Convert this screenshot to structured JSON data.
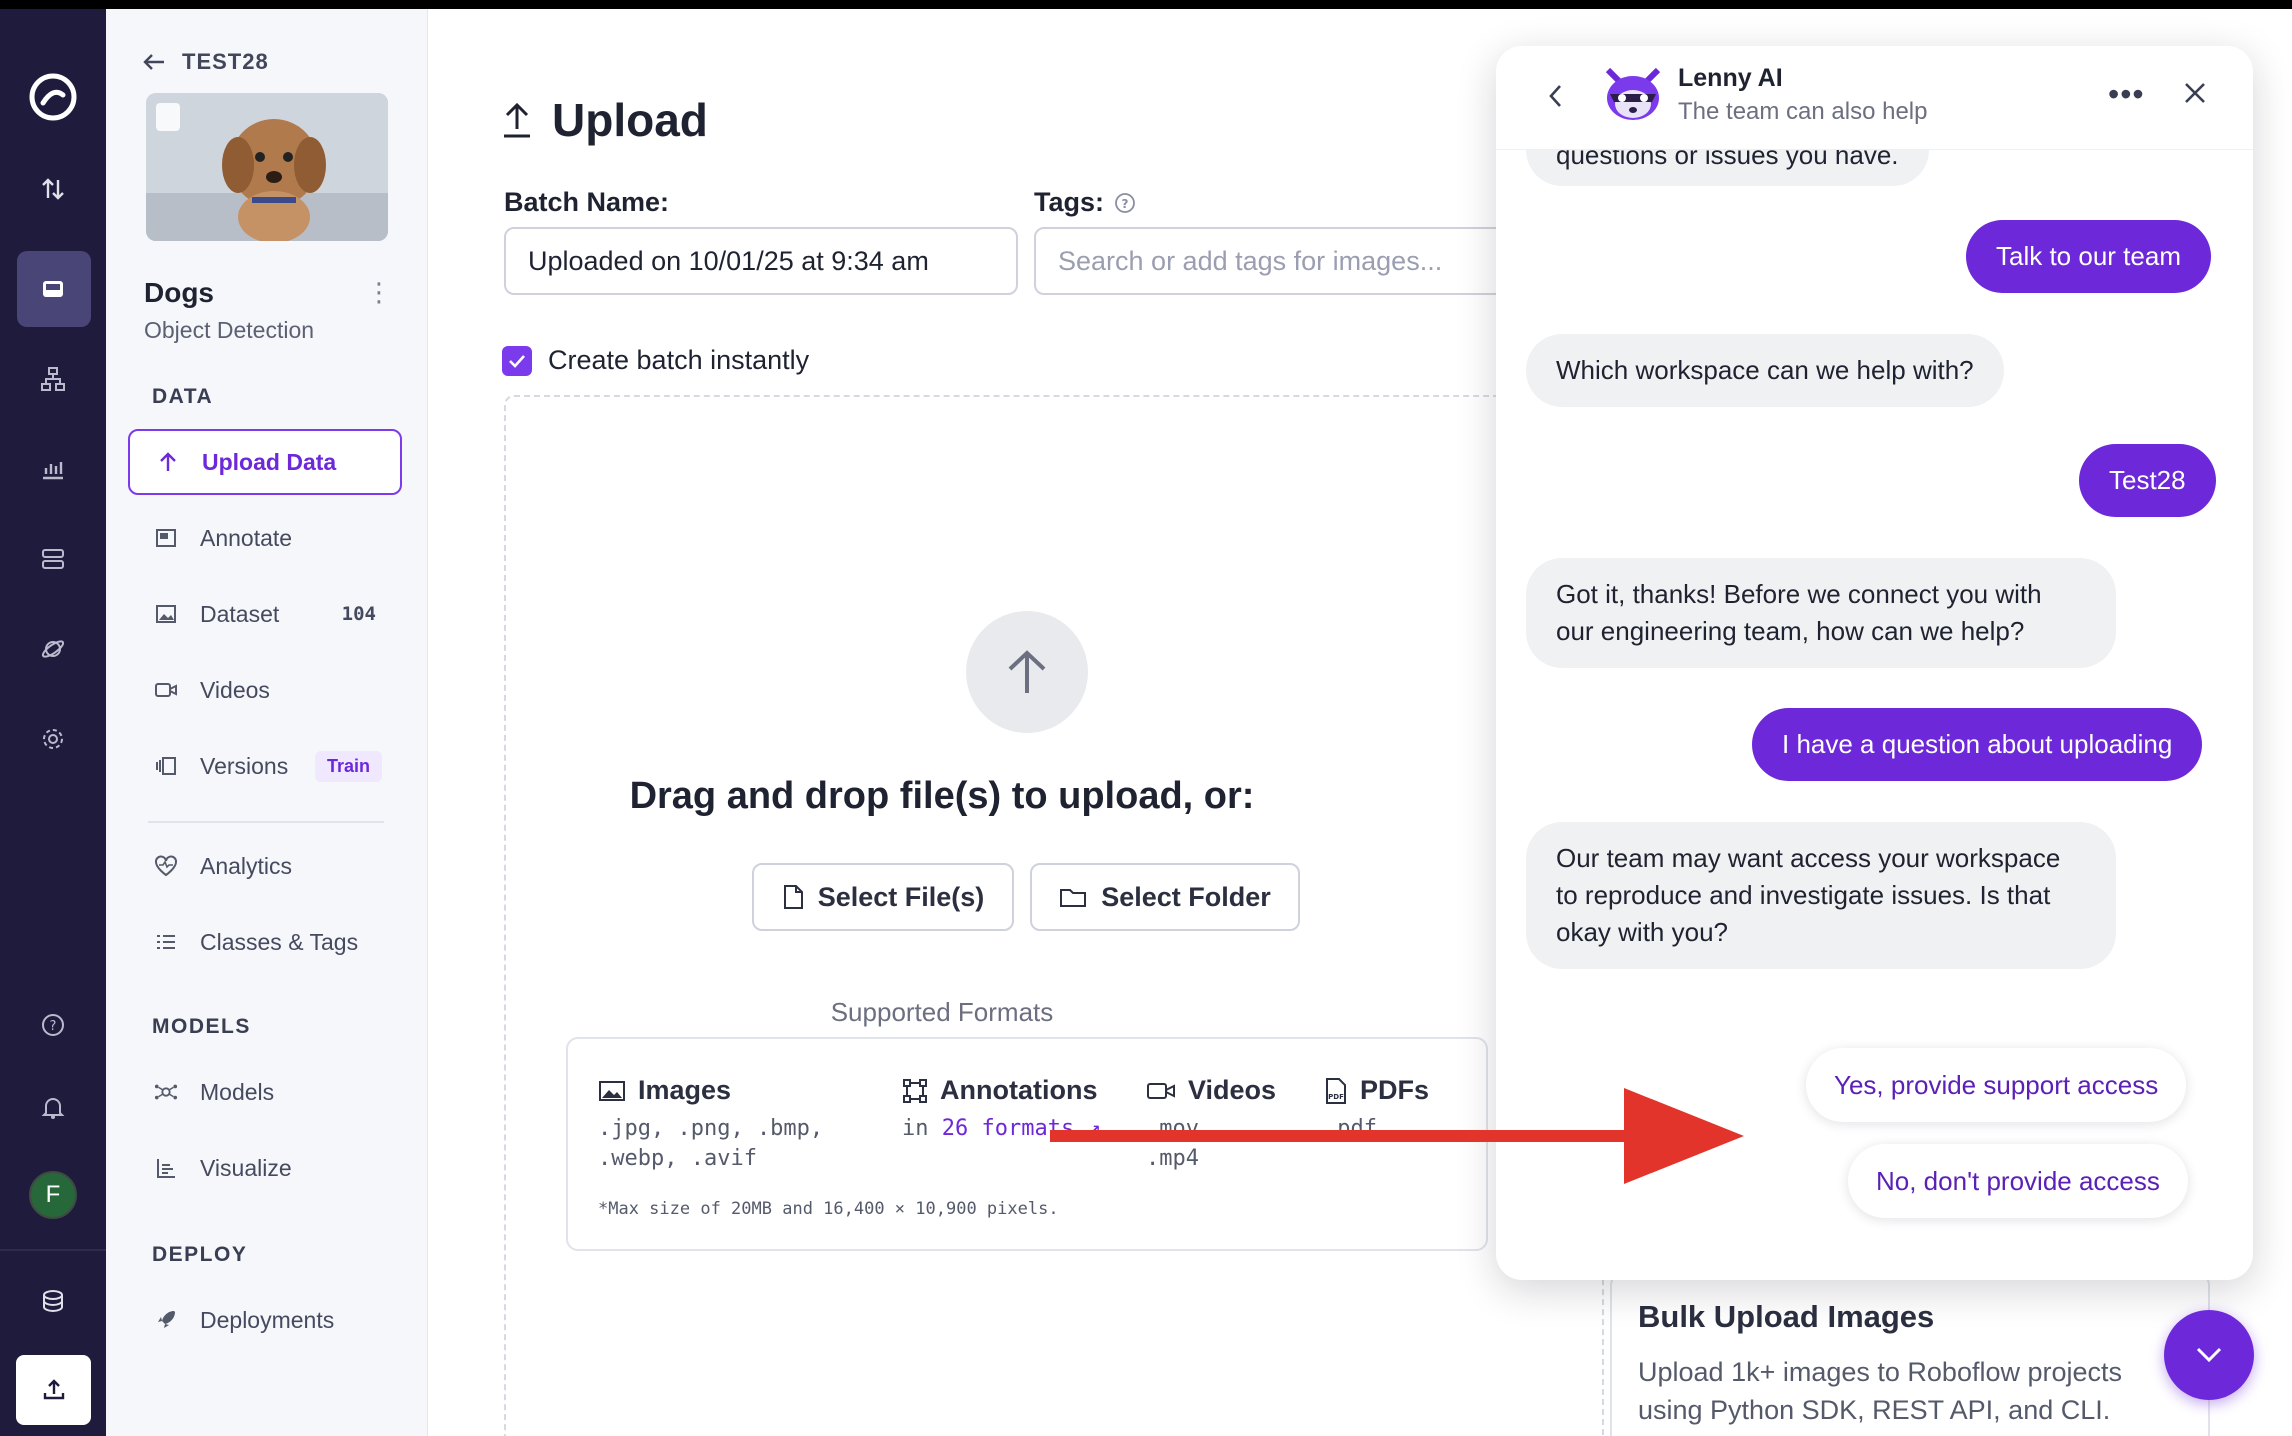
{
  "sidebar": {
    "project_code": "TEST28",
    "project_name": "Dogs",
    "project_type": "Object Detection",
    "section_data": "DATA",
    "section_models": "MODELS",
    "section_deploy": "DEPLOY",
    "items": {
      "upload": "Upload Data",
      "annotate": "Annotate",
      "dataset": "Dataset",
      "dataset_count": "104",
      "videos": "Videos",
      "versions": "Versions",
      "versions_badge": "Train",
      "analytics": "Analytics",
      "classes": "Classes & Tags",
      "models": "Models",
      "visualize": "Visualize",
      "deployments": "Deployments"
    },
    "avatar_letter": "F"
  },
  "main": {
    "title": "Upload",
    "batch_label": "Batch Name:",
    "batch_value": "Uploaded on 10/01/25 at 9:34 am",
    "tags_label": "Tags:",
    "tags_placeholder": "Search or add tags for images...",
    "create_batch": "Create batch instantly",
    "drop_text": "Drag and drop file(s) to upload, or:",
    "select_files": "Select File(s)",
    "select_folder": "Select Folder",
    "supported": "Supported Formats",
    "formats": {
      "images_h": "Images",
      "images_v": ".jpg, .png, .bmp,\n.webp, .avif",
      "ann_h": "Annotations",
      "ann_prefix": "in ",
      "ann_link": "26 formats ↗",
      "videos_h": "Videos",
      "videos_v": ".mov,\n.mp4",
      "pdfs_h": "PDFs",
      "pdfs_v": ".pdf",
      "note": "*Max size of 20MB and 16,400 × 10,900 pixels."
    },
    "bulk_title": "Bulk Upload Images",
    "bulk_desc": "Upload 1k+ images to Roboflow projects using Python SDK, REST API, and CLI."
  },
  "chat": {
    "name": "Lenny AI",
    "subtitle": "The team can also help",
    "msg_cut": "questions or issues you have.",
    "msg_talk": "Talk to our team",
    "msg_workspace": "Which workspace can we help with?",
    "msg_test28": "Test28",
    "msg_gotit": "Got it, thanks! Before we connect you with our engineering team, how can we help?",
    "msg_question": "I have a question about uploading",
    "msg_access": "Our team may want access your workspace to reproduce and investigate issues. Is that okay with you?",
    "opt_yes": "Yes, provide support access",
    "opt_no": "No, don't provide access"
  },
  "colors": {
    "accent": "#6d28d9",
    "rail": "#1f1b3c",
    "arrow": "#e2342a"
  }
}
